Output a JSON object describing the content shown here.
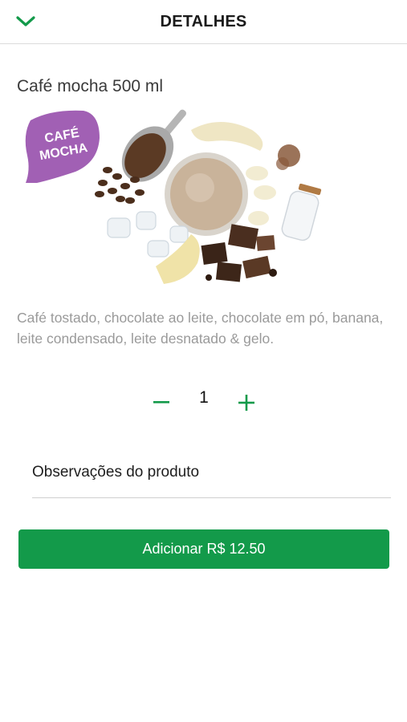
{
  "header": {
    "title": "DETALHES",
    "back_icon": "chevron-down-icon"
  },
  "product": {
    "name": "Café mocha 500 ml",
    "badge_line1": "CAFÉ",
    "badge_line2": "MOCHA",
    "description": "Café tostado, chocolate ao leite, chocolate em pó, banana, leite condensado, leite desnatado & gelo."
  },
  "quantity": {
    "value": "1",
    "minus_icon": "minus-icon",
    "plus_icon": "plus-icon"
  },
  "notes": {
    "placeholder": "Observações do produto",
    "value": ""
  },
  "add_button": {
    "label": "Adicionar R$ 12.50"
  },
  "colors": {
    "accent": "#139a4a",
    "badge": "#a160b4",
    "description_text": "#9a9a9a"
  }
}
